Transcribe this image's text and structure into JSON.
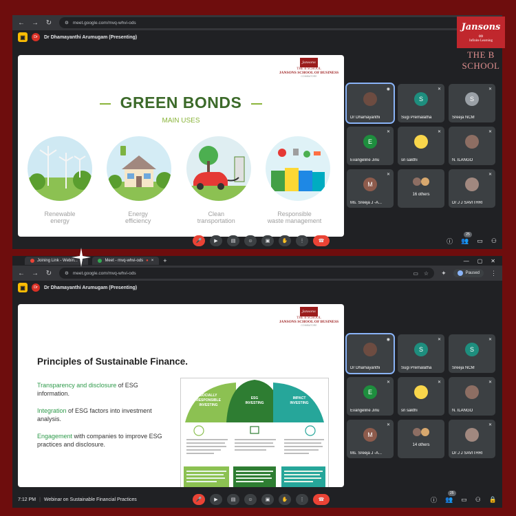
{
  "brand": {
    "name": "Jansons",
    "tagline": "Infinite Learning",
    "school": "THE B SCHOOL"
  },
  "top": {
    "url": "meet.google.com/mvq-whvi-ods",
    "presenter_initials": "Dr",
    "presenter": "Dr Dhamayanthi Arumugam (Presenting)",
    "slide": {
      "logo_mark": "Jansons",
      "logo_bs": "THE B SCHOOL",
      "logo_name": "JANSONS SCHOOL OF BUSINESS",
      "logo_sub": "COIMBATORE",
      "title": "GREEN BONDS",
      "subtitle": "MAIN USES",
      "uses": [
        {
          "line1": "Renewable",
          "line2": "energy"
        },
        {
          "line1": "Energy",
          "line2": "efficiency"
        },
        {
          "line1": "Clean",
          "line2": "transportation"
        },
        {
          "line1": "Responsible",
          "line2": "waste management"
        }
      ]
    },
    "participants": [
      {
        "initial": "",
        "name": "Dr Dhamayanthi",
        "color": "#6d4c41"
      },
      {
        "initial": "S",
        "name": "Sugi Premalatha",
        "color": "#1e8e7e"
      },
      {
        "initial": "S",
        "name": "Sreeja NCM",
        "color": "#9aa0a6"
      },
      {
        "initial": "E",
        "name": "Evangeline Jinu",
        "color": "#1e8e3e"
      },
      {
        "initial": "",
        "name": "sri sakthi",
        "color": "#f9d64b"
      },
      {
        "initial": "",
        "name": "N. ILANGO",
        "color": "#8d6e63"
      },
      {
        "initial": "M",
        "name": "Ms. Sreeja J -A...",
        "color": "#8d5b4c"
      },
      {
        "initial": "",
        "name": "16 others",
        "color": "#5f6368"
      },
      {
        "initial": "",
        "name": "Dr J J SAVITHRI",
        "color": "#a1887f"
      }
    ],
    "people_count": "25"
  },
  "bottom": {
    "tabs": [
      "Joining Link - Webin...",
      "Meet - mvq-whvi-ods"
    ],
    "url": "meet.google.com/mvq-whvi-ods",
    "paused": "Paused",
    "presenter_initials": "Dr",
    "presenter": "Dr Dhamayanthi Arumugam (Presenting)",
    "slide": {
      "logo_mark": "Jansons",
      "logo_bs": "THE B SCHOOL",
      "logo_name": "JANSONS SCHOOL OF BUSINESS",
      "logo_sub": "COIMBATORE",
      "title": "Principles of Sustainable Finance.",
      "bullets": [
        {
          "lead": "Transparency and disclosure",
          "rest": " of ESG information."
        },
        {
          "lead": "Integration",
          "rest": " of ESG factors into investment analysis."
        },
        {
          "lead": "Engagement",
          "rest": " with companies to improve ESG practices and disclosure."
        }
      ],
      "diagram": {
        "sections": [
          {
            "line1": "SOCIALLY",
            "line2": "RESPONSIBLE",
            "line3": "INVESTING"
          },
          {
            "line1": "ESG",
            "line2": "INVESTING",
            "line3": ""
          },
          {
            "line1": "IMPACT",
            "line2": "INVESTING",
            "line3": ""
          }
        ]
      }
    },
    "participants": [
      {
        "initial": "",
        "name": "Dr Dhamayanthi",
        "color": "#6d4c41"
      },
      {
        "initial": "S",
        "name": "Sugi Premalatha",
        "color": "#1e8e7e"
      },
      {
        "initial": "S",
        "name": "Sreeja NCM",
        "color": "#1e8e7e"
      },
      {
        "initial": "E",
        "name": "Evangeline Jinu",
        "color": "#1e8e3e"
      },
      {
        "initial": "",
        "name": "sri sakthi",
        "color": "#f9d64b"
      },
      {
        "initial": "",
        "name": "N. ILANGO",
        "color": "#8d6e63"
      },
      {
        "initial": "M",
        "name": "Ms. Sreeja J -A...",
        "color": "#8d5b4c"
      },
      {
        "initial": "",
        "name": "14 others",
        "color": "#5f6368"
      },
      {
        "initial": "",
        "name": "Dr J J SAVITHRI",
        "color": "#a1887f"
      }
    ],
    "time": "7:12 PM",
    "meeting_title": "Webinar on Sustainable Financial Practices",
    "people_count": "25"
  }
}
